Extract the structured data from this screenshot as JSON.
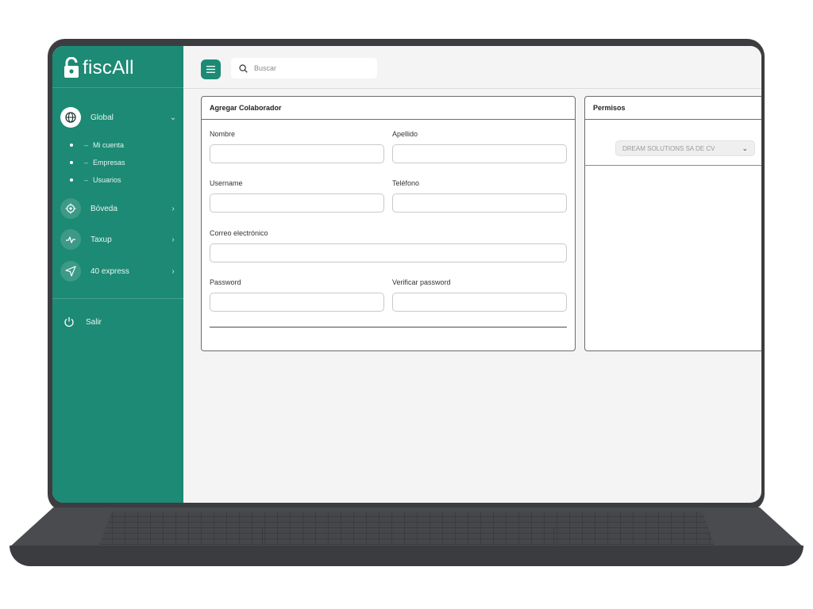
{
  "app": {
    "logo_text": "fiscAll",
    "brand_color": "#1c8a74"
  },
  "sidebar": {
    "items": [
      {
        "label": "Global",
        "icon": "globe-icon",
        "chevron": "⌄"
      },
      {
        "label": "Bóveda",
        "icon": "target-icon",
        "chevron": "›"
      },
      {
        "label": "Taxup",
        "icon": "activity-icon",
        "chevron": "›"
      },
      {
        "label": "40 express",
        "icon": "send-icon",
        "chevron": "›"
      }
    ],
    "sub_items": [
      {
        "label": "Mi cuenta"
      },
      {
        "label": "Empresas"
      },
      {
        "label": "Usuarios"
      }
    ],
    "logout": {
      "label": "Salir",
      "icon": "power-icon"
    }
  },
  "topbar": {
    "search_placeholder": "Buscar"
  },
  "form": {
    "title": "Agregar Colaborador",
    "fields": {
      "nombre": {
        "label": "Nombre",
        "value": ""
      },
      "apellido": {
        "label": "Apellido",
        "value": ""
      },
      "username": {
        "label": "Username",
        "value": ""
      },
      "telefono": {
        "label": "Teléfono",
        "value": ""
      },
      "correo": {
        "label": "Correo electrónico",
        "value": ""
      },
      "password": {
        "label": "Password",
        "value": ""
      },
      "verificar": {
        "label": "Verificar password",
        "value": ""
      }
    }
  },
  "permisos": {
    "title": "Permisos",
    "company_select": {
      "value": "DREAM SOLUTIONS SA DE CV"
    }
  }
}
